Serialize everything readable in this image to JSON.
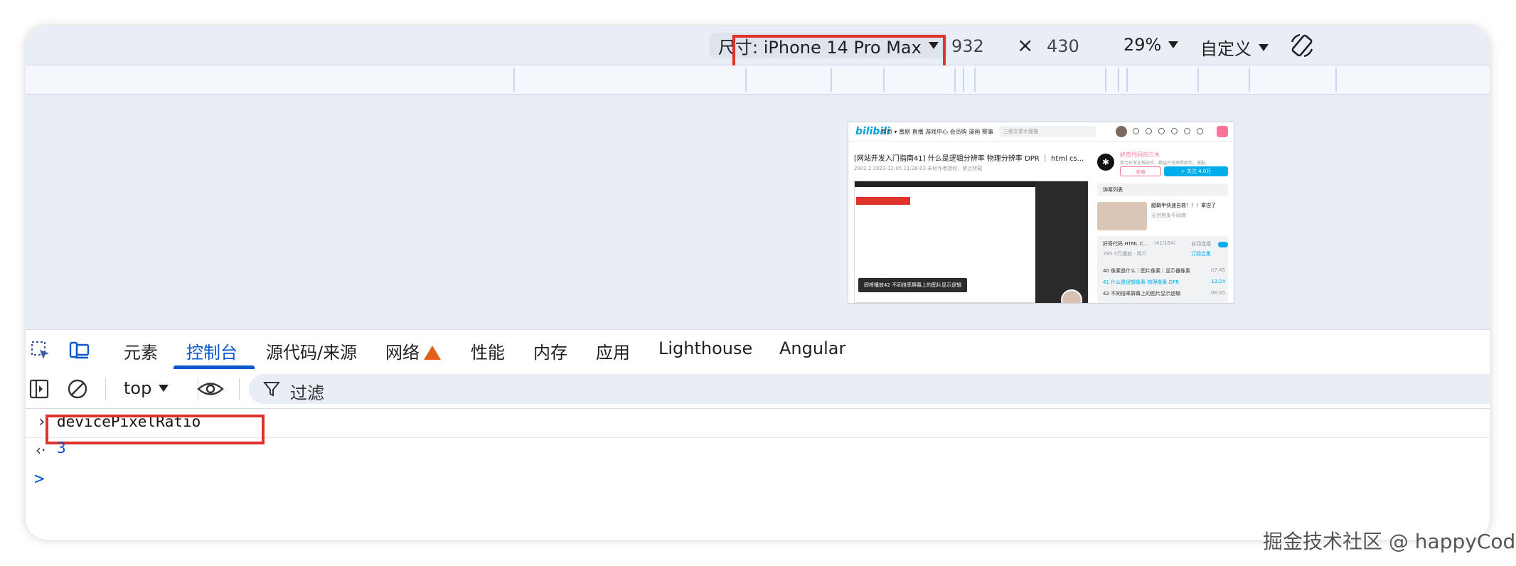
{
  "device_toolbar": {
    "device_label": "尺寸: iPhone 14 Pro Max",
    "width": "932",
    "times": "×",
    "height": "430",
    "zoom": "29%",
    "throttle": "自定义",
    "rotate_icon": "rotate-icon"
  },
  "preview": {
    "logo": "bilibili",
    "nav": "首页 ▾  番剧  直播  游戏中心  会员购  漫画  赛事",
    "search_placeholder": "三维文章大搜搜",
    "title": "[网站开发入门指南41] 什么是逻辑分辨率 物理分辨率 DPR ｜ html cs...",
    "meta": "2802   2   2023-12-05 11:26:03   未经作者授权，禁止转载",
    "toast": "即将播放42 不同倍率屏幕上的图片显示逻辑",
    "up_name": "好奇代码的三木",
    "up_desc": "致力开发全栈经验，精益开发来帮助你，速配。",
    "charge": "充电",
    "follow": "+ 关注 4.0万",
    "danmaku": "弹幕列表",
    "rec_title": "腱鞘甲快速自救！！！拿捏了",
    "rec_up": "无剑官发不同商",
    "playlist_title": "好奇代码 HTML C...",
    "playlist_count": "(41/164)",
    "autoplay": "自动连播",
    "playlist_meta": "785.5万播放  · 简介",
    "subscribe": "订阅合集",
    "item1": "40 像素是什么｜图片像素｜显示器像素",
    "item1_time": "07:45",
    "item2": "41 什么是逻辑像素 物理像素 DPR",
    "item2_time": "13:24",
    "item3": "42 不同倍率屏幕上的图片显示逻辑",
    "item3_time": "06:45"
  },
  "tabs": [
    "元素",
    "控制台",
    "源代码/来源",
    "网络",
    "性能",
    "内存",
    "应用",
    "Lighthouse",
    "Angular"
  ],
  "console_toolbar": {
    "context": "top",
    "filter_label": "过滤"
  },
  "console": {
    "input": "devicePixelRatio",
    "result": "3",
    "prompt": ">"
  },
  "watermark": "掘金技术社区 @ happyCoder",
  "colors": {
    "accent": "#0b57d0",
    "highlight": "#e0322d",
    "warning": "#e2601a"
  }
}
